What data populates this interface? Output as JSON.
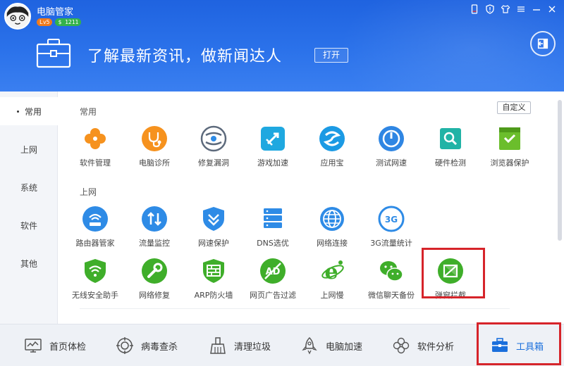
{
  "app": {
    "name": "电脑管家",
    "level": "Lv5",
    "coins": "$ 1211"
  },
  "window_controls": [
    "phone-icon",
    "shield-icon",
    "shirt-icon",
    "menu-icon",
    "minimize-icon",
    "close-icon"
  ],
  "banner": {
    "text": "了解最新资讯，做新闻达人",
    "button": "打开"
  },
  "sidebar": {
    "items": [
      {
        "label": "常用",
        "active": true
      },
      {
        "label": "上网",
        "active": false
      },
      {
        "label": "系统",
        "active": false
      },
      {
        "label": "软件",
        "active": false
      },
      {
        "label": "其他",
        "active": false
      }
    ]
  },
  "content": {
    "custom_button": "自定义",
    "sections": [
      {
        "title": "常用",
        "tools": [
          {
            "label": "软件管理",
            "icon": "clover-icon",
            "color": "#f6921e"
          },
          {
            "label": "电脑诊所",
            "icon": "stethoscope-icon",
            "color": "#f6921e"
          },
          {
            "label": "修复漏洞",
            "icon": "patch-icon",
            "color": "#5d6a7c"
          },
          {
            "label": "游戏加速",
            "icon": "game-boost-icon",
            "color": "#1fa8e0"
          },
          {
            "label": "应用宝",
            "icon": "app-store-icon",
            "color": "#1b9ae4"
          },
          {
            "label": "测试网速",
            "icon": "speedometer-icon",
            "color": "#2f86e3"
          },
          {
            "label": "硬件检测",
            "icon": "chip-icon",
            "color": "#21b3a6"
          },
          {
            "label": "浏览器保护",
            "icon": "browser-shield-icon",
            "color": "#6bbe2c"
          }
        ]
      },
      {
        "title": "上网",
        "tools": [
          {
            "label": "路由器管家",
            "icon": "router-icon",
            "color": "#2e8be6"
          },
          {
            "label": "流量监控",
            "icon": "traffic-arrows-icon",
            "color": "#2e8be6"
          },
          {
            "label": "网速保护",
            "icon": "speed-shield-icon",
            "color": "#2e8be6"
          },
          {
            "label": "DNS选优",
            "icon": "dns-server-icon",
            "color": "#2e8be6"
          },
          {
            "label": "网络连接",
            "icon": "globe-icon",
            "color": "#2e8be6"
          },
          {
            "label": "3G流量统计",
            "icon": "3g-icon",
            "color": "#2e8be6"
          },
          {
            "label": "无线安全助手",
            "icon": "wifi-shield-icon",
            "color": "#3fae2a"
          },
          {
            "label": "网络修复",
            "icon": "wrench-icon",
            "color": "#3fae2a"
          },
          {
            "label": "ARP防火墙",
            "icon": "firewall-icon",
            "color": "#3fae2a"
          },
          {
            "label": "网页广告过滤",
            "icon": "ad-block-icon",
            "color": "#3fae2a"
          },
          {
            "label": "上网慢",
            "icon": "ie-icon",
            "color": "#3fae2a"
          },
          {
            "label": "微信聊天备份",
            "icon": "wechat-icon",
            "color": "#3fae2a"
          },
          {
            "label": "弹窗拦截",
            "icon": "popup-block-icon",
            "color": "#3fae2a"
          }
        ]
      }
    ]
  },
  "bottom_nav": [
    {
      "label": "首页体检",
      "icon": "monitor-chart-icon",
      "active": false
    },
    {
      "label": "病毒查杀",
      "icon": "virus-target-icon",
      "active": false
    },
    {
      "label": "清理垃圾",
      "icon": "broom-icon",
      "active": false
    },
    {
      "label": "电脑加速",
      "icon": "rocket-icon",
      "active": false
    },
    {
      "label": "软件分析",
      "icon": "clover-outline-icon",
      "active": false
    },
    {
      "label": "工具箱",
      "icon": "toolbox-icon",
      "active": true
    }
  ],
  "colors": {
    "header": "#2b6fe8",
    "highlight_box": "#d6242a",
    "active_nav": "#1a6fdc"
  }
}
